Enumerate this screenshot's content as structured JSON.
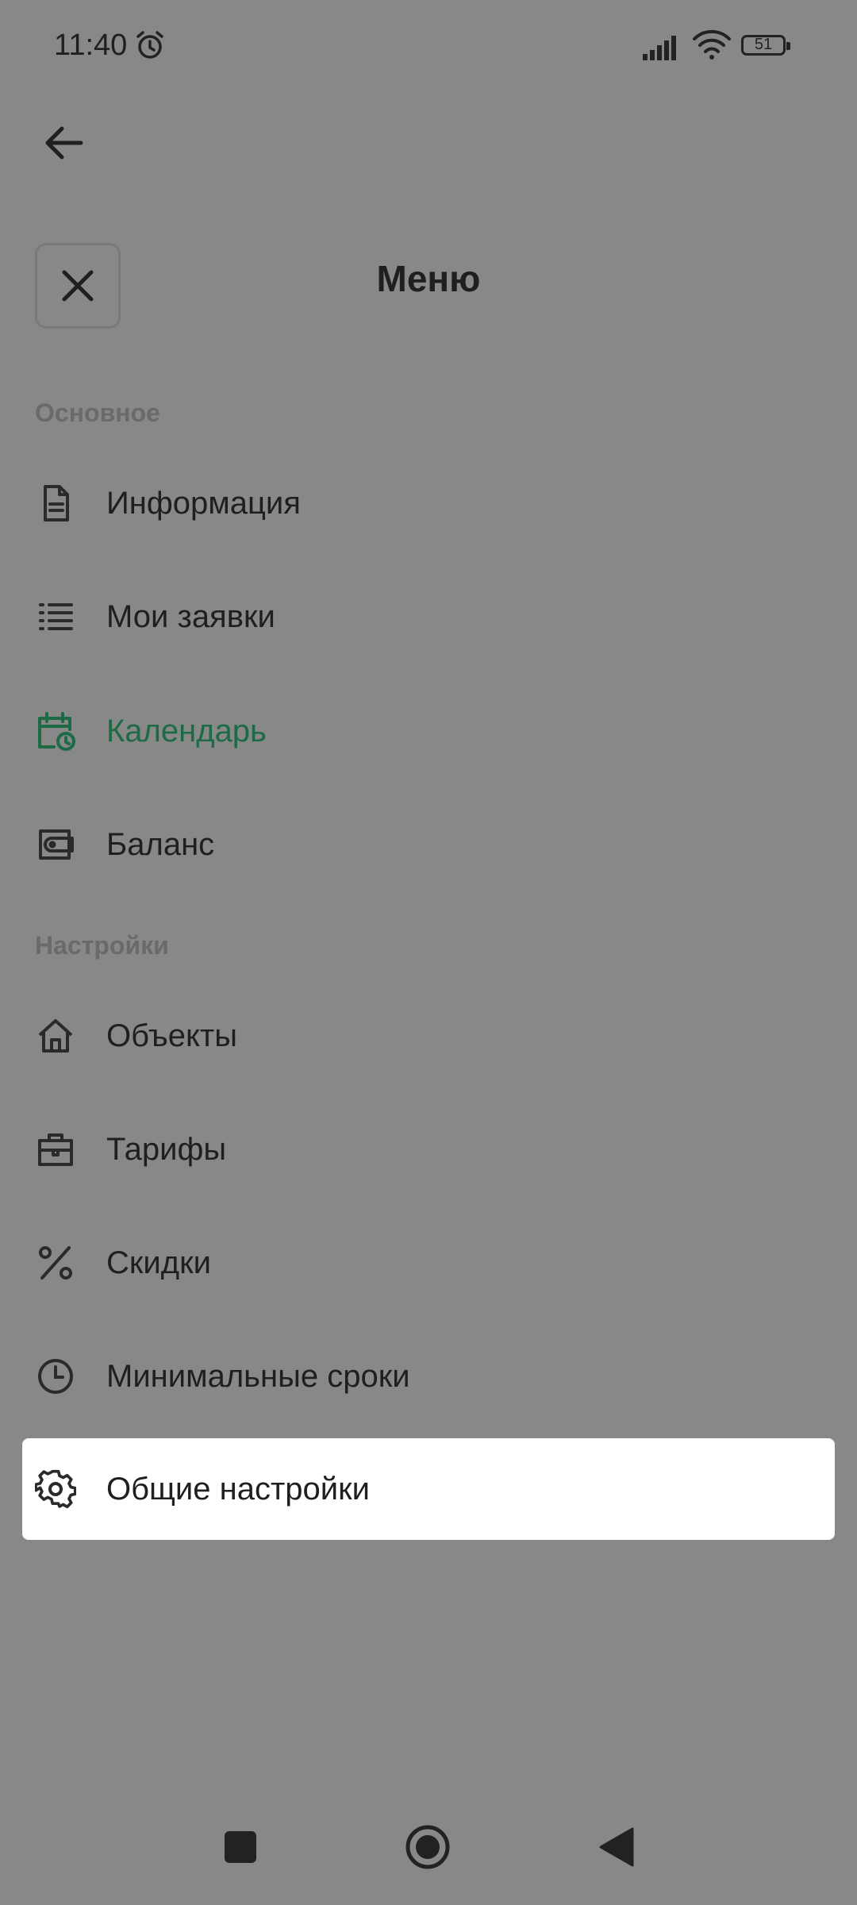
{
  "status_bar": {
    "time": "11:40",
    "battery": "51"
  },
  "header": {
    "title": "Меню"
  },
  "sections": [
    {
      "title": "Основное",
      "items": [
        {
          "label": "Информация",
          "icon": "document-icon",
          "active": false
        },
        {
          "label": "Мои заявки",
          "icon": "list-icon",
          "active": false
        },
        {
          "label": "Календарь",
          "icon": "calendar-clock-icon",
          "active": true
        },
        {
          "label": "Баланс",
          "icon": "wallet-icon",
          "active": false
        }
      ]
    },
    {
      "title": "Настройки",
      "items": [
        {
          "label": "Объекты",
          "icon": "home-icon",
          "active": false
        },
        {
          "label": "Тарифы",
          "icon": "briefcase-icon",
          "active": false
        },
        {
          "label": "Скидки",
          "icon": "percent-icon",
          "active": false
        },
        {
          "label": "Минимальные сроки",
          "icon": "clock-icon",
          "active": false
        },
        {
          "label": "Общие настройки",
          "icon": "gear-icon",
          "active": false,
          "highlighted": true
        }
      ]
    }
  ],
  "colors": {
    "overlay": "#888888",
    "accent": "#1d6b45",
    "highlight": "#ffffff"
  }
}
